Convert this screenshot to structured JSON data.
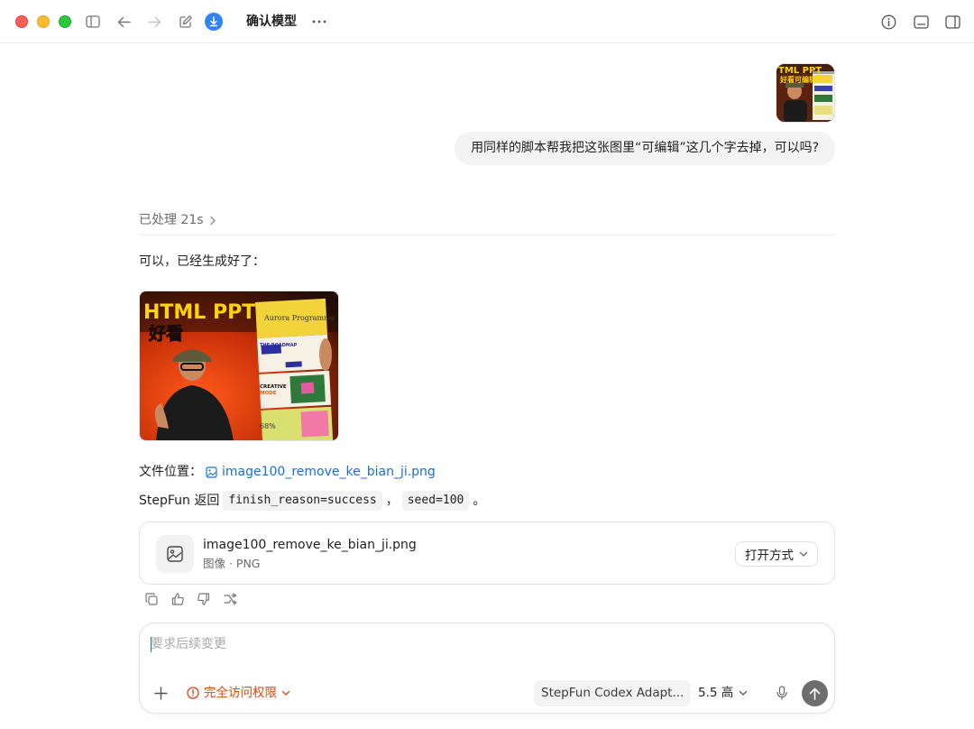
{
  "window": {
    "title": "确认模型",
    "icons": [
      "sidebar-toggle-icon",
      "back-arrow-icon",
      "forward-arrow-icon",
      "new-chat-icon",
      "download-icon",
      "more-icon",
      "info-icon",
      "panel-bottom-icon",
      "panel-right-icon"
    ]
  },
  "colors": {
    "accent_blue": "#1a6fd4",
    "download_badge": "#2f84f5",
    "warning_orange": "#d9480f",
    "bubble_bg": "#f3f3f3"
  },
  "conversation": {
    "user_message": "用同样的脚本帮我把这张图里“可编辑”这几个字去掉，可以吗?",
    "processed_label": "已处理 21s",
    "reply_intro": "可以，已经生成好了：",
    "image_headline": "HTML PPT",
    "image_subtext": "好看",
    "image_cards": {
      "card1": "Aurora Programme",
      "card2": "THE ROADMAP",
      "card3_a": "CREATIVE",
      "card3_b": "MODE",
      "card4": "68%"
    },
    "file_location_label": "文件位置：",
    "file_link": "image100_remove_ke_bian_ji.png",
    "return_prefix": "StepFun 返回",
    "code_1": "finish_reason=success",
    "separator": "，",
    "code_2": "seed=100",
    "end_punct": "。"
  },
  "file_card": {
    "name": "image100_remove_ke_bian_ji.png",
    "meta": "图像 · PNG",
    "open_label": "打开方式"
  },
  "message_actions": [
    "copy-icon",
    "thumbs-up-icon",
    "thumbs-down-icon",
    "fork-icon"
  ],
  "composer": {
    "placeholder": "要求后续变更",
    "access_label": "完全访问权限",
    "model_label": "StepFun Codex Adapt...",
    "effort_label": "5.5 高"
  }
}
